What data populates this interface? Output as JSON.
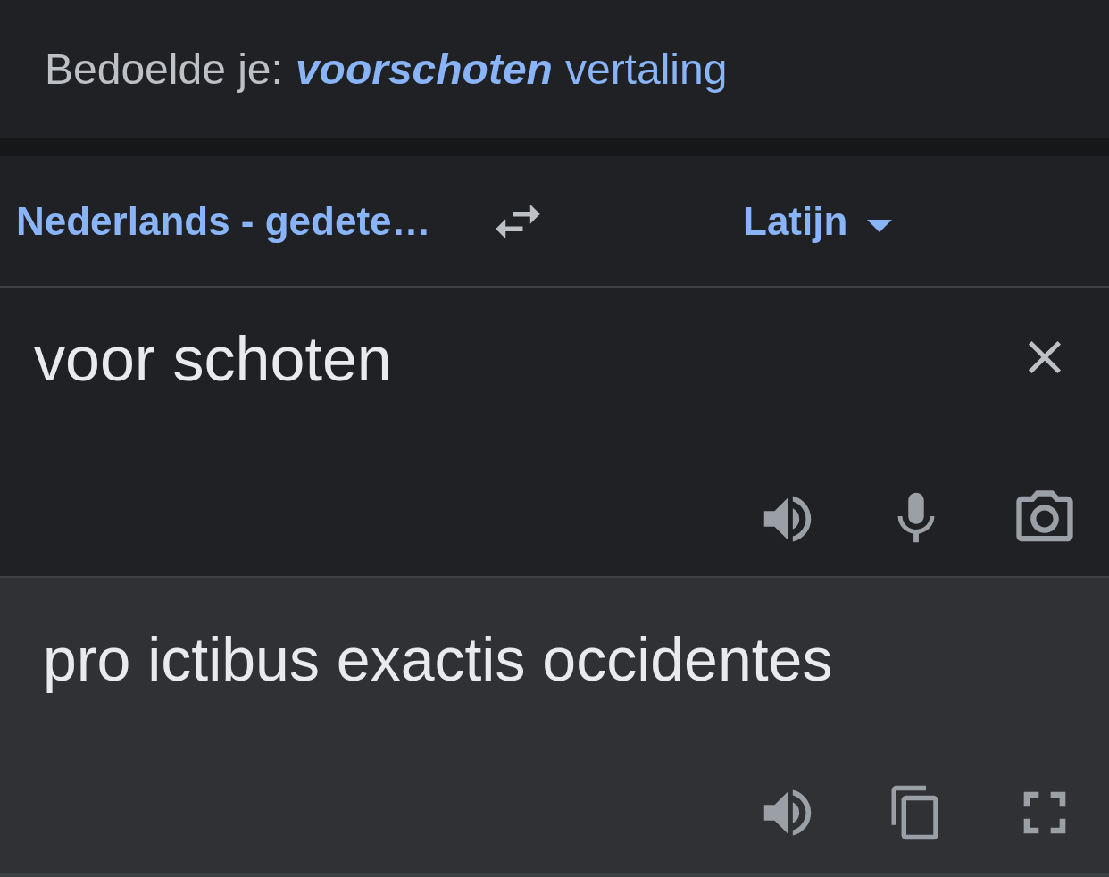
{
  "suggestion": {
    "prefix": "Bedoelde je:",
    "term": "voorschoten",
    "rest": "vertaling"
  },
  "languages": {
    "source": "Nederlands - gedete…",
    "target": "Latijn"
  },
  "input": {
    "value": "voor schoten"
  },
  "output": {
    "text": "pro ictibus exactis occidentes"
  }
}
